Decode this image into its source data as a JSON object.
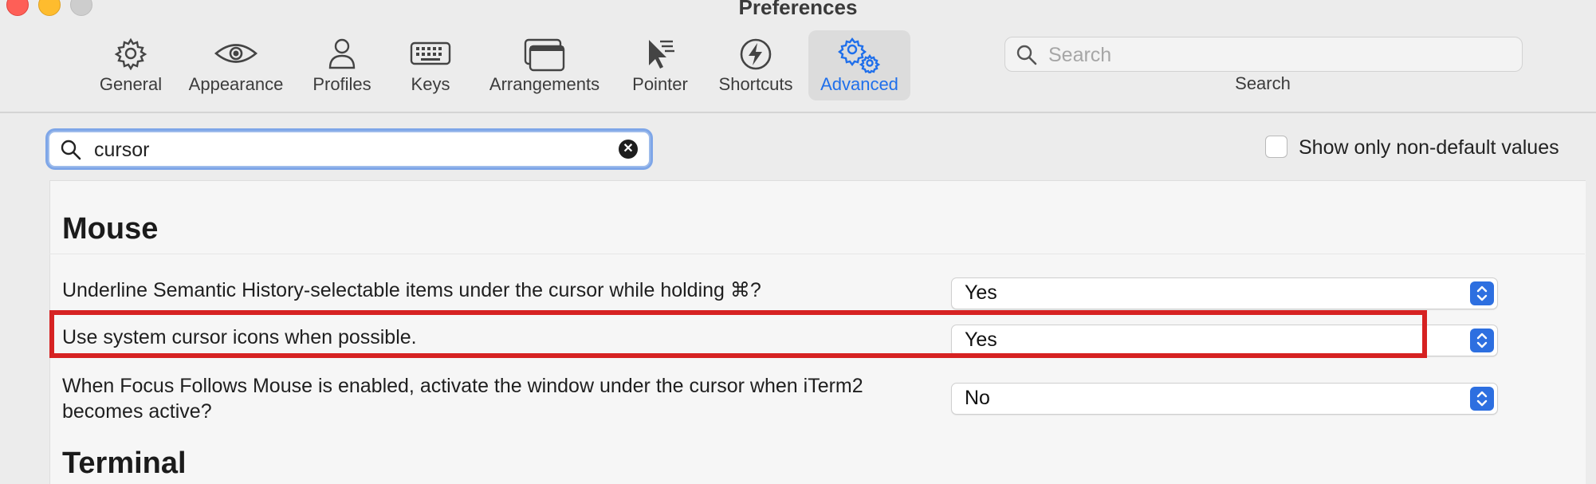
{
  "window": {
    "title": "Preferences"
  },
  "toolbar": {
    "items": [
      {
        "label": "General",
        "icon": "gear-icon"
      },
      {
        "label": "Appearance",
        "icon": "eye-icon"
      },
      {
        "label": "Profiles",
        "icon": "person-icon"
      },
      {
        "label": "Keys",
        "icon": "keyboard-icon"
      },
      {
        "label": "Arrangements",
        "icon": "windows-icon"
      },
      {
        "label": "Pointer",
        "icon": "pointer-icon"
      },
      {
        "label": "Shortcuts",
        "icon": "bolt-icon"
      },
      {
        "label": "Advanced",
        "icon": "gears-icon"
      }
    ],
    "active": "Advanced",
    "search_placeholder": "Search",
    "search_label": "Search"
  },
  "filter": {
    "value": "cursor",
    "nondefault_label": "Show only non-default values",
    "nondefault_checked": false
  },
  "sections": [
    {
      "title": "Mouse",
      "rows": [
        {
          "label": "Underline Semantic History-selectable items under the cursor while holding ⌘?",
          "value": "Yes"
        },
        {
          "label": "Use system cursor icons when possible.",
          "value": "Yes"
        },
        {
          "label_line1": "When Focus Follows Mouse is enabled, activate the window under the cursor when iTerm2",
          "label_line2": "becomes active?",
          "value": "No"
        }
      ]
    },
    {
      "title": "Terminal"
    }
  ],
  "colors": {
    "accent": "#2d6fe0",
    "highlight_box": "#d62222",
    "active_tab_text": "#1f6feb"
  }
}
